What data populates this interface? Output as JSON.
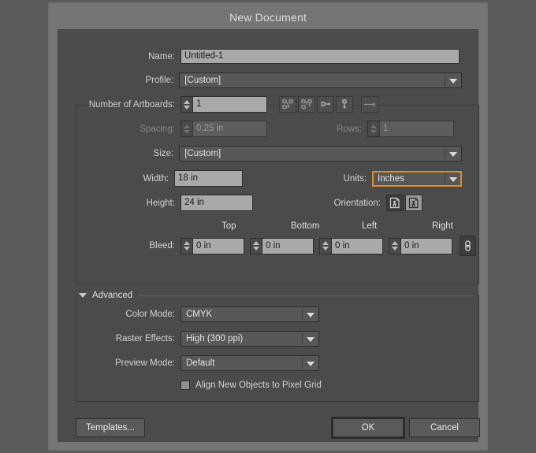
{
  "window": {
    "title": "New Document"
  },
  "fields": {
    "name_label": "Name:",
    "name_value": "Untitled-1",
    "profile_label": "Profile:",
    "profile_value": "[Custom]",
    "artboards_label": "Number of Artboards:",
    "artboards_value": "1",
    "spacing_label": "Spacing:",
    "spacing_value": "0,25 in",
    "rows_label": "Rows:",
    "rows_value": "1",
    "size_label": "Size:",
    "size_value": "[Custom]",
    "width_label": "Width:",
    "width_value": "18 in",
    "height_label": "Height:",
    "height_value": "24 in",
    "units_label": "Units:",
    "units_value": "Inches",
    "orientation_label": "Orientation:",
    "bleed_label": "Bleed:",
    "bleed_top_header": "Top",
    "bleed_bottom_header": "Bottom",
    "bleed_left_header": "Left",
    "bleed_right_header": "Right",
    "bleed_top_value": "0 in",
    "bleed_bottom_value": "0 in",
    "bleed_left_value": "0 in",
    "bleed_right_value": "0 in"
  },
  "advanced": {
    "section_label": "Advanced",
    "color_mode_label": "Color Mode:",
    "color_mode_value": "CMYK",
    "raster_label": "Raster Effects:",
    "raster_value": "High (300 ppi)",
    "preview_label": "Preview Mode:",
    "preview_value": "Default",
    "align_pixel_grid_label": "Align New Objects to Pixel Grid",
    "align_pixel_grid_checked": false
  },
  "buttons": {
    "templates": "Templates...",
    "ok": "OK",
    "cancel": "Cancel"
  },
  "icons": {
    "artboard_grid_row": "artboard-grid-by-row-icon",
    "artboard_grid_column": "artboard-grid-by-column-icon",
    "artboard_row": "artboard-arrange-by-row-icon",
    "artboard_column": "artboard-arrange-by-column-icon",
    "artboard_direction": "artboard-layout-direction-icon",
    "orientation_portrait": "orientation-portrait-icon",
    "orientation_landscape": "orientation-landscape-icon",
    "bleed_link": "bleed-link-icon"
  },
  "colors": {
    "backdrop": "#5b5b5b",
    "dialog_chrome": "#757575",
    "dialog_body": "#4b4b4b",
    "focus_accent": "#e08a26",
    "input_light": "#a9a9a9",
    "dropdown_dark": "#575757"
  }
}
